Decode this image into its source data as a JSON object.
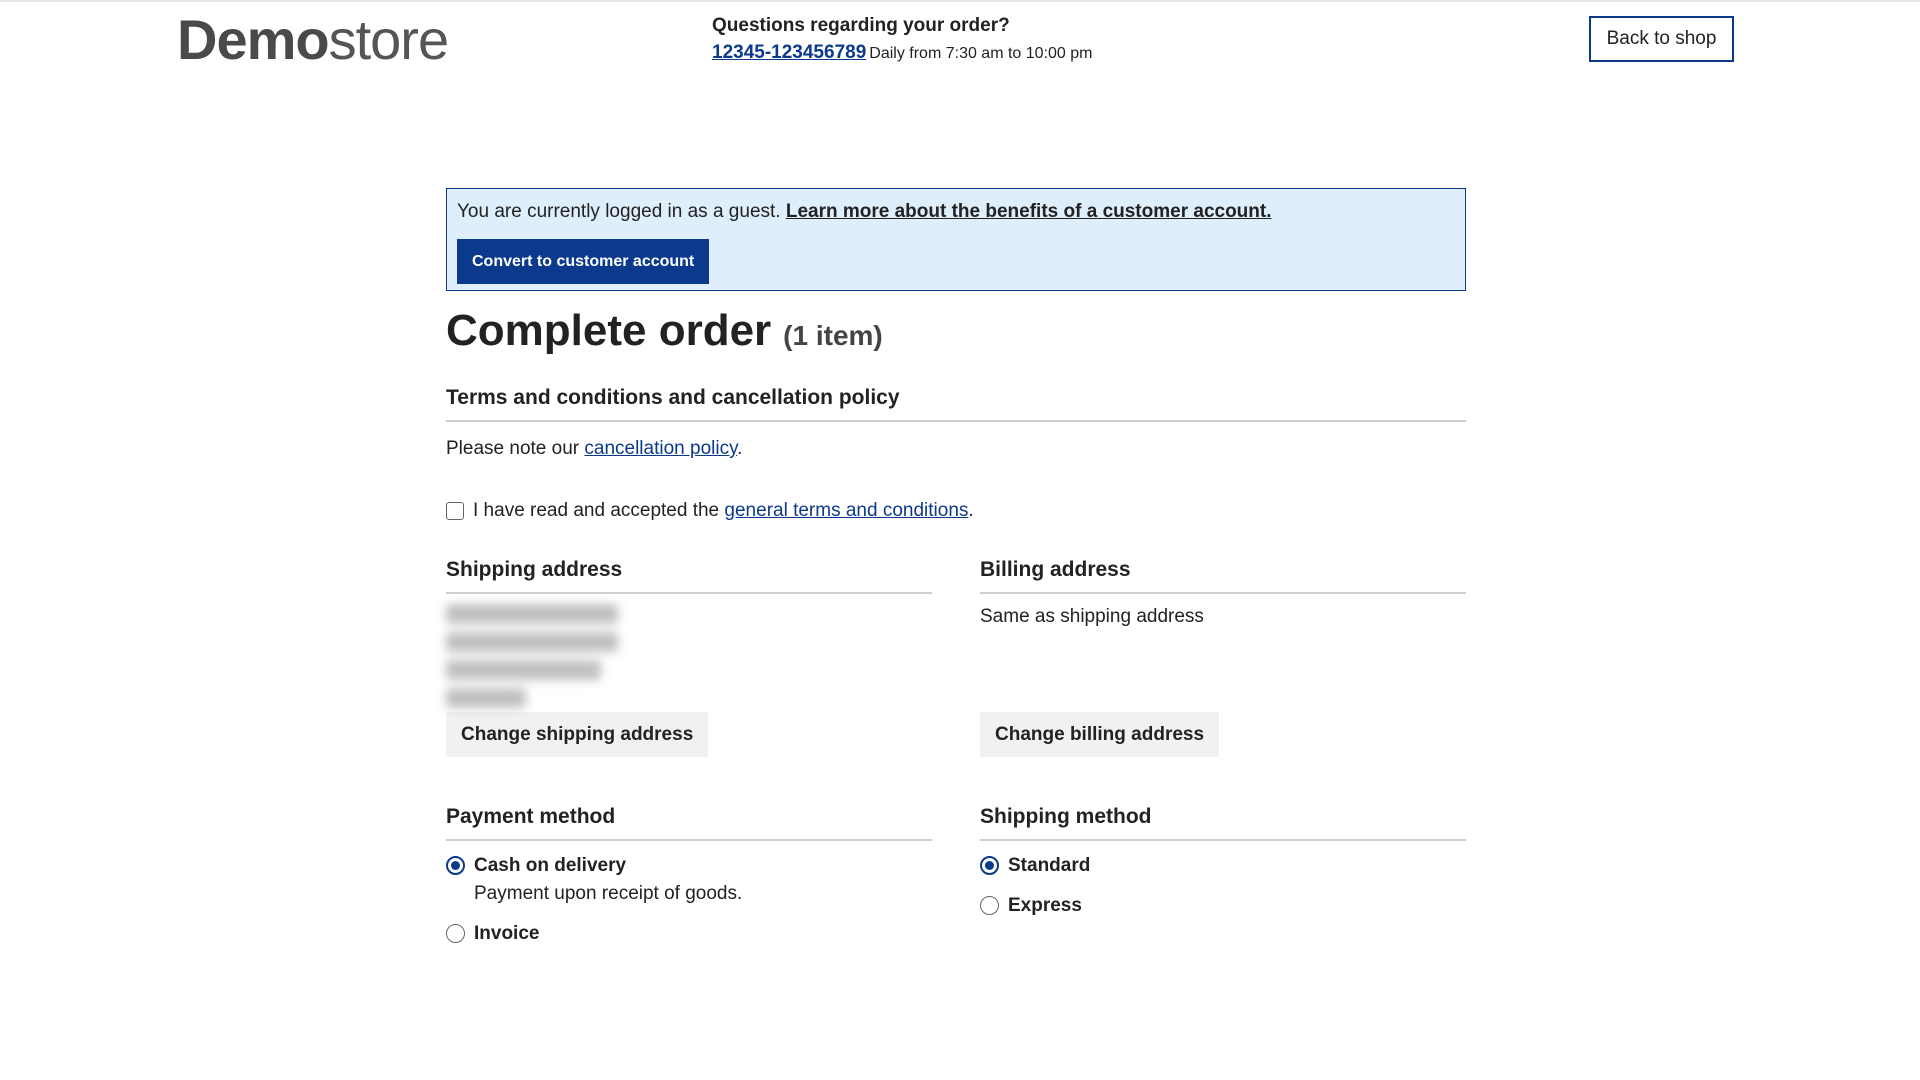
{
  "header": {
    "logo_bold": "Demo",
    "logo_light": "store",
    "contact_title": "Questions regarding your order?",
    "phone": "12345-123456789",
    "hours": "Daily from 7:30 am to 10:00 pm",
    "back_label": "Back to shop"
  },
  "guest": {
    "text": "You are currently logged in as a guest.",
    "link": "Learn more about the benefits of a customer account.",
    "convert_label": "Convert to customer account"
  },
  "page": {
    "title": "Complete order",
    "item_count": "(1 item)"
  },
  "terms": {
    "title": "Terms and conditions and cancellation policy",
    "note_prefix": "Please note our",
    "note_link": "cancellation policy",
    "note_suffix": ".",
    "accept_prefix": "I have read and accepted the",
    "accept_link": "general terms and conditions",
    "accept_suffix": ".",
    "accepted": false
  },
  "shipping_address": {
    "title": "Shipping address",
    "change_label": "Change shipping address"
  },
  "billing_address": {
    "title": "Billing address",
    "text": "Same as shipping address",
    "change_label": "Change billing address"
  },
  "payment": {
    "title": "Payment method",
    "options": [
      {
        "label": "Cash on delivery",
        "description": "Payment upon receipt of goods.",
        "selected": true
      },
      {
        "label": "Invoice",
        "selected": false
      }
    ]
  },
  "shipping_method": {
    "title": "Shipping method",
    "options": [
      {
        "label": "Standard",
        "selected": true
      },
      {
        "label": "Express",
        "selected": false
      }
    ]
  },
  "colors": {
    "accent": "#0b3a8c",
    "info_background": "#dfeefb"
  }
}
